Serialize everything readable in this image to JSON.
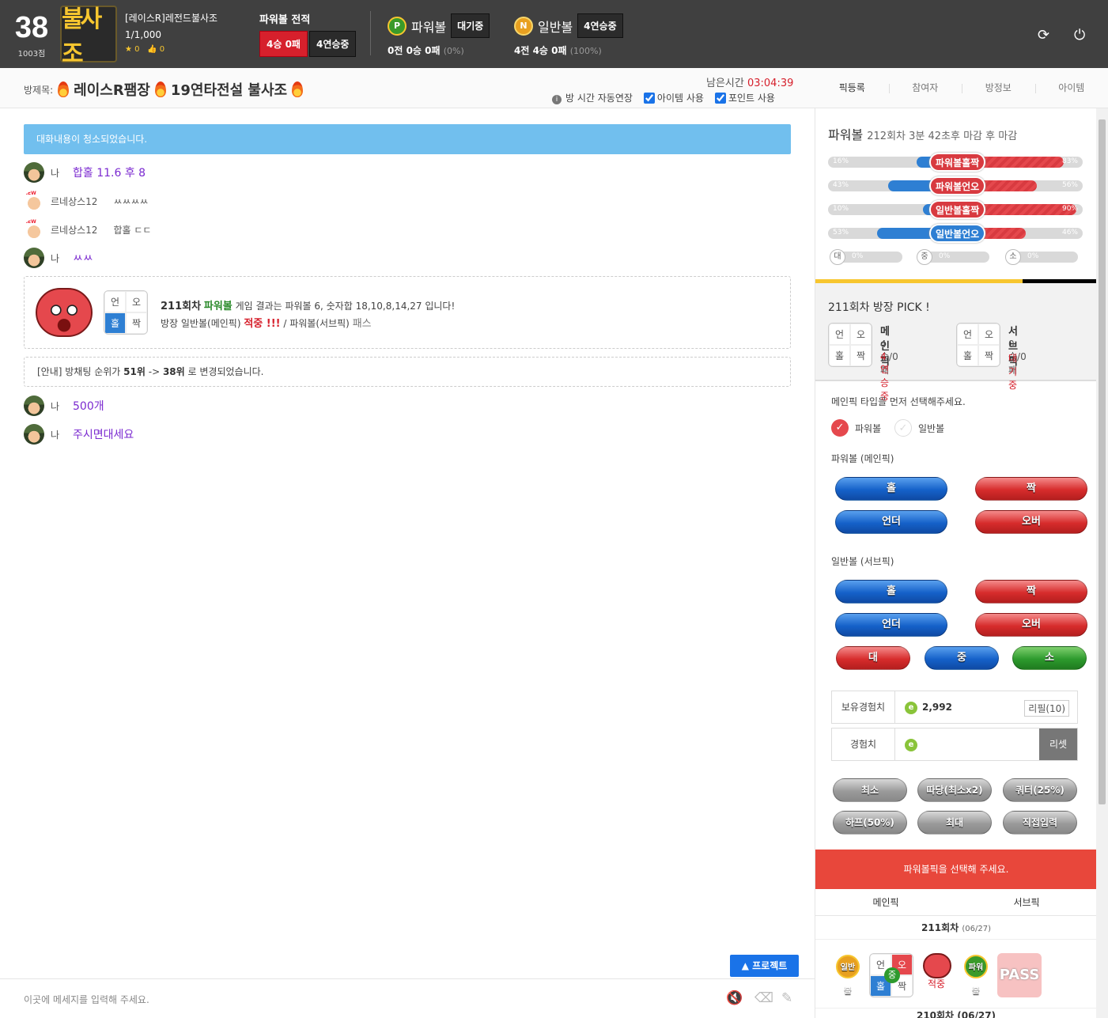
{
  "user": {
    "level": "38",
    "score": "1003점",
    "logo_text": "불사조",
    "name": "[레이스R]레전드불사조",
    "points": "1/1,000",
    "stars": "0",
    "likes": "0"
  },
  "powerball_record": {
    "title": "파워볼 전적",
    "record": "4승 0패",
    "streak": "4연승중"
  },
  "balls": [
    {
      "icon": "P",
      "name": "파워볼",
      "status": "대기중",
      "record": "0전 0승 0패",
      "pct": "(0%)",
      "color": "#3a9a2a"
    },
    {
      "icon": "N",
      "name": "일반볼",
      "status": "4연승중",
      "record": "4전 4승 0패",
      "pct": "(100%)",
      "color": "#e8a020"
    }
  ],
  "room": {
    "label": "방제목:",
    "title_1": "레이스R팸장",
    "title_2": "19연타전설 불사조",
    "remain_label": "남은시간",
    "remain_time": "03:04:39",
    "auto_extend": "방 시간 자동연장",
    "use_items": "아이템 사용",
    "use_points": "포인트 사용"
  },
  "tabs": [
    "픽등록",
    "참여자",
    "방정보",
    "아이템"
  ],
  "chat": {
    "notice": "대화내용이 청소되었습니다.",
    "messages": [
      {
        "who": "나",
        "text": "합홀 11.6 후 8"
      },
      {
        "who": "르네상스12",
        "text": "ㅆㅆㅆㅆ"
      },
      {
        "who": "르네상스12",
        "text": "합홀 ㄷㄷ"
      },
      {
        "who": "나",
        "text": "ㅆㅆ"
      },
      {
        "who": "나",
        "text": "500개"
      },
      {
        "who": "나",
        "text": "주시면대세요"
      }
    ],
    "result": {
      "grid": [
        "언",
        "오",
        "홀",
        "짝"
      ],
      "round": "211회차",
      "game": "파워볼",
      "line1_rest": "게임 결과는 파워볼 6, 숫자합 18,10,8,14,27 입니다!",
      "line2_a": "방장 일반볼(메인픽)",
      "line2_hit": "적중 !!!",
      "line2_b": "/ 파워볼(서브픽)",
      "line2_pass": "패스"
    },
    "rank_notice": {
      "a": "[안내] 방채팅 순위가",
      "from": "51위",
      "arrow": "->",
      "to": "38위",
      "b": "로 변경되었습니다."
    },
    "project_button": "▲ 프로젝트",
    "input_placeholder": "이곳에 메세지를 입력해 주세요."
  },
  "side": {
    "head_title": "파워볼",
    "head_sub": "212회차 3분 42초후 마감 후 마감",
    "bars": [
      {
        "left": "16%",
        "label": "파워볼홀짝",
        "right": "83%",
        "lc": "#2e7fd3",
        "rc": "#e5484d",
        "labcol": "#d83a40"
      },
      {
        "left": "43%",
        "label": "파워볼언오",
        "right": "56%",
        "lc": "#2e7fd3",
        "rc": "#e5484d",
        "labcol": "#d83a40"
      },
      {
        "left": "10%",
        "label": "일반볼홀짝",
        "right": "90%",
        "lc": "#2e7fd3",
        "rc": "#e5484d",
        "labcol": "#d83a40"
      },
      {
        "left": "53%",
        "label": "일반볼언오",
        "right": "46%",
        "lc": "#2e7fd3",
        "rc": "#e5484d",
        "labcol": "#2e7fd3"
      }
    ],
    "sizes": [
      {
        "icon": "대",
        "pct": "0%"
      },
      {
        "icon": "중",
        "pct": "0%"
      },
      {
        "icon": "소",
        "pct": "0%"
      }
    ],
    "pick": {
      "title": "211회차 방장 PICK !",
      "main": {
        "title": "메인픽",
        "record": "4승/0패",
        "status": "4연승중"
      },
      "sub": {
        "title": "서브픽",
        "record": "0승/0패",
        "status": "대기중"
      },
      "grid": [
        "언",
        "오",
        "홀",
        "짝"
      ]
    },
    "select_prompt": "메인픽 타입을 먼저 선택해주세요.",
    "radio_powerball": "파워볼",
    "radio_normal": "일반볼",
    "pb_head": "파워볼 (메인픽)",
    "nb_head": "일반볼 (서브픽)",
    "btn_odd": "홀",
    "btn_even": "짝",
    "btn_under": "언더",
    "btn_over": "오버",
    "btn_big": "대",
    "btn_mid": "중",
    "btn_small": "소",
    "exp_label": "보유경험치",
    "exp_value": "2,992",
    "refill": "리필(10)",
    "exp2_label": "경험치",
    "reset": "리셋",
    "amounts": [
      "최소",
      "따당(최소x2)",
      "쿼터(25%)",
      "하프(50%)",
      "최대",
      "직접입력"
    ],
    "warn": "파워볼픽을 선택해 주세요.",
    "ptabs": [
      "메인픽",
      "서브픽"
    ],
    "hist_round": "211회차",
    "hist_date": "(06/27)",
    "hist_normal": "일반볼",
    "hist_power": "파워볼",
    "hist_mid": "중",
    "hist_hit": "적중",
    "hist_pass": "PASS",
    "next_round": "210회차 (06/27)"
  }
}
